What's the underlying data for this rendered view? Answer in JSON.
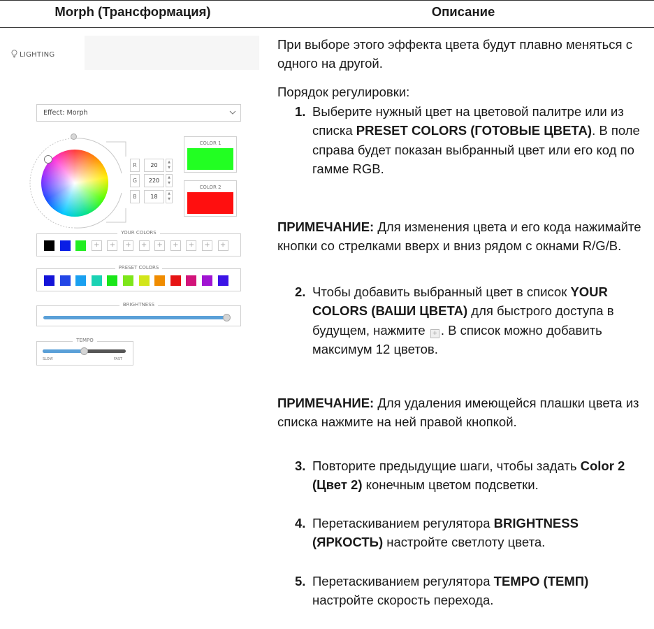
{
  "header": {
    "col1": "Morph (Трансформация)",
    "col2": "Описание"
  },
  "panel": {
    "tab_label": "LIGHTING",
    "effect_label": "Effect: Morph",
    "rgb": [
      {
        "letter": "R",
        "value": "20"
      },
      {
        "letter": "G",
        "value": "220"
      },
      {
        "letter": "B",
        "value": "18"
      }
    ],
    "color1": {
      "label": "COLOR 1",
      "color": "#22ff22"
    },
    "color2": {
      "label": "COLOR 2",
      "color": "#ff0f0f"
    },
    "your_colors": {
      "label": "YOUR COLORS",
      "filled": [
        "#000000",
        "#0a1ee6",
        "#22ee22"
      ],
      "empty_count": 9,
      "empty_glyph": "+"
    },
    "preset_colors": {
      "label": "PRESET COLORS",
      "colors": [
        "#1414d8",
        "#2346e6",
        "#1aa0f0",
        "#1ad2b4",
        "#1ae61a",
        "#7ee61a",
        "#d2e61a",
        "#f08c00",
        "#e61414",
        "#d2147a",
        "#a014d2",
        "#3c14e6"
      ]
    },
    "brightness": {
      "label": "BRIGHTNESS",
      "level": 1.0
    },
    "tempo": {
      "label": "TEMPO",
      "slow": "SLOW",
      "fast": "FAST",
      "level": 0.5
    },
    "accent": "#5aa0d8"
  },
  "desc": {
    "intro": "При выборе этого эффекта цвета будут плавно меняться с одного на другой.",
    "order": "Порядок регулировки:",
    "step1": {
      "num": "1.",
      "text_a": "Выберите нужный цвет на цветовой палитре или из списка",
      "bold_a": "PRESET COLORS (ГОТОВЫЕ ЦВЕТА)",
      "text_b": ". В поле справа будет показан выбранный цвет или его код по гамме RGB."
    },
    "note1": {
      "label": "ПРИМЕЧАНИЕ:",
      "text": "Для изменения цвета и его кода нажимайте кнопки со стрелками вверх и вниз рядом с окнами R/G/B."
    },
    "step2": {
      "num": "2.",
      "text_a": "Чтобы добавить выбранный цвет в список",
      "bold_a": "YOUR COLORS (ВАШИ ЦВЕТА)",
      "text_b": "для быстрого доступа в будущем, нажмите",
      "text_c": ". В список можно добавить максимум 12 цветов."
    },
    "note2": {
      "label": "ПРИМЕЧАНИЕ:",
      "text": "Для удаления имеющейся плашки цвета из списка нажмите на ней правой кнопкой."
    },
    "step3": {
      "num": "3.",
      "text_a": "Повторите предыдущие шаги, чтобы задать",
      "bold_a": "Color 2 (Цвет 2)",
      "text_b": "конечным цветом подсветки."
    },
    "step4": {
      "num": "4.",
      "text_a": "Перетаскиванием регулятора",
      "bold_a": "BRIGHTNESS (ЯРКОСТЬ)",
      "text_b": "настройте светлоту цвета."
    },
    "step5": {
      "num": "5.",
      "text_a": "Перетаскиванием регулятора",
      "bold_a": "TEMPO (ТЕМП)",
      "text_b": "настройте скорость перехода."
    }
  }
}
